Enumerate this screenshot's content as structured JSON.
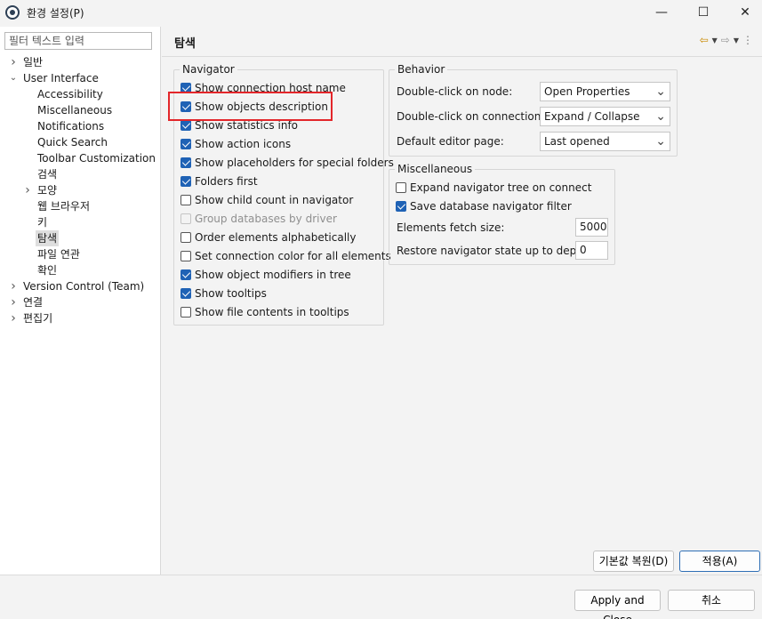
{
  "window": {
    "title": "환경 설정(P)",
    "minimize_glyph": "—",
    "maximize_glyph": "☐",
    "close_glyph": "✕"
  },
  "sidebar": {
    "filter_placeholder": "필터 텍스트 입력",
    "items": [
      {
        "label": "일반",
        "level": 0,
        "expander": "collapsed"
      },
      {
        "label": "User Interface",
        "level": 0,
        "expander": "expanded"
      },
      {
        "label": "Accessibility",
        "level": 1,
        "expander": "none"
      },
      {
        "label": "Miscellaneous",
        "level": 1,
        "expander": "none"
      },
      {
        "label": "Notifications",
        "level": 1,
        "expander": "none"
      },
      {
        "label": "Quick Search",
        "level": 1,
        "expander": "none"
      },
      {
        "label": "Toolbar Customization",
        "level": 1,
        "expander": "none"
      },
      {
        "label": "검색",
        "level": 1,
        "expander": "none"
      },
      {
        "label": "모양",
        "level": 1,
        "expander": "collapsed"
      },
      {
        "label": "웹 브라우저",
        "level": 1,
        "expander": "none"
      },
      {
        "label": "키",
        "level": 1,
        "expander": "none"
      },
      {
        "label": "탐색",
        "level": 1,
        "expander": "none",
        "selected": true
      },
      {
        "label": "파일 연관",
        "level": 1,
        "expander": "none"
      },
      {
        "label": "확인",
        "level": 1,
        "expander": "none"
      },
      {
        "label": "Version Control (Team)",
        "level": 0,
        "expander": "collapsed"
      },
      {
        "label": "연결",
        "level": 0,
        "expander": "collapsed"
      },
      {
        "label": "편집기",
        "level": 0,
        "expander": "collapsed"
      }
    ]
  },
  "page": {
    "title": "탐색"
  },
  "navigator": {
    "legend": "Navigator",
    "options": [
      {
        "label": "Show connection host name",
        "checked": true,
        "enabled": true
      },
      {
        "label": "Show objects description",
        "checked": true,
        "enabled": true
      },
      {
        "label": "Show statistics info",
        "checked": true,
        "enabled": true
      },
      {
        "label": "Show action icons",
        "checked": true,
        "enabled": true
      },
      {
        "label": "Show placeholders for special folders",
        "checked": true,
        "enabled": true
      },
      {
        "label": "Folders first",
        "checked": true,
        "enabled": true
      },
      {
        "label": "Show child count in navigator",
        "checked": false,
        "enabled": true
      },
      {
        "label": "Group databases by driver",
        "checked": false,
        "enabled": false
      },
      {
        "label": "Order elements alphabetically",
        "checked": false,
        "enabled": true
      },
      {
        "label": "Set connection color for all elements",
        "checked": false,
        "enabled": true
      },
      {
        "label": "Show object modifiers in tree",
        "checked": true,
        "enabled": true
      },
      {
        "label": "Show tooltips",
        "checked": true,
        "enabled": true
      },
      {
        "label": "Show file contents in tooltips",
        "checked": false,
        "enabled": true
      }
    ]
  },
  "behavior": {
    "legend": "Behavior",
    "rows": [
      {
        "label": "Double-click on node:",
        "value": "Open Properties"
      },
      {
        "label": "Double-click on connection:",
        "value": "Expand / Collapse"
      },
      {
        "label": "Default editor page:",
        "value": "Last opened"
      }
    ]
  },
  "misc": {
    "legend": "Miscellaneous",
    "checks": [
      {
        "label": "Expand navigator tree on connect",
        "checked": false
      },
      {
        "label": "Save database navigator filter",
        "checked": true
      }
    ],
    "fetch_label": "Elements fetch size:",
    "fetch_value": "5000",
    "depth_label": "Restore navigator state up to depth:",
    "depth_value": "0"
  },
  "buttons": {
    "restore_defaults": "기본값 복원(D)",
    "apply": "적용(A)",
    "apply_close": "Apply and Close",
    "cancel": "취소"
  },
  "colors": {
    "accent": "#1f62b5",
    "highlight": "#e3262a"
  }
}
